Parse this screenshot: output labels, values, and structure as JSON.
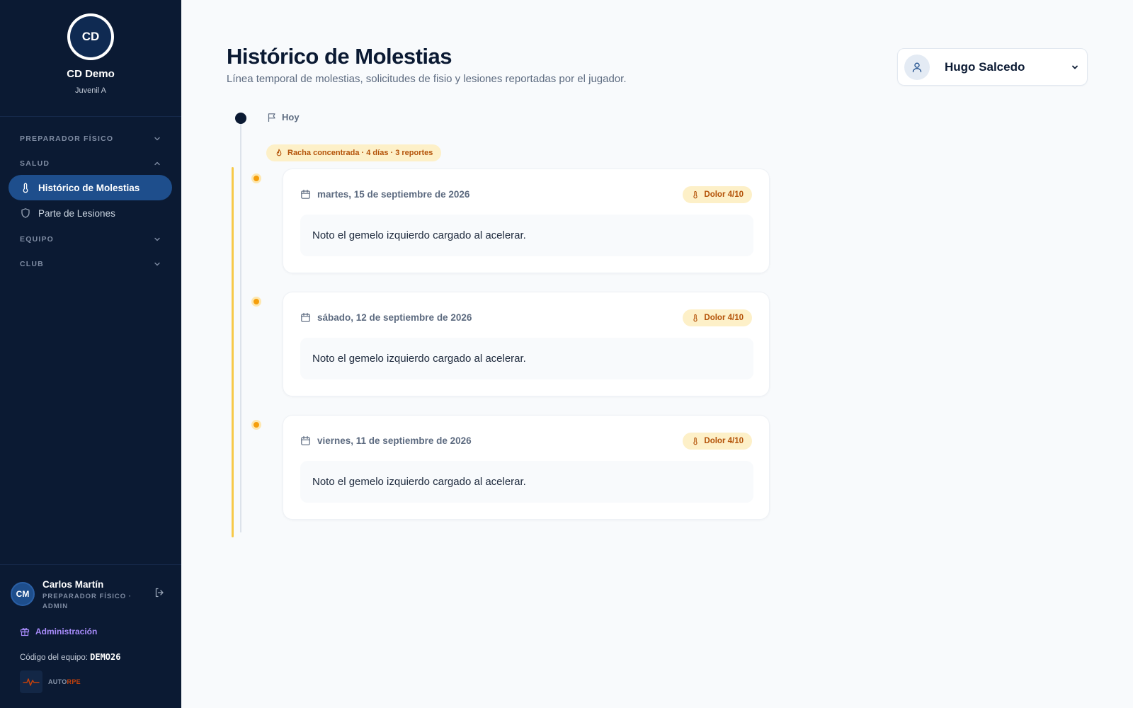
{
  "club": {
    "logo_initials": "CD",
    "name": "CD Demo",
    "team": "Juvenil A"
  },
  "nav": {
    "sections": [
      {
        "label": "PREPARADOR FÍSICO",
        "expanded": false
      },
      {
        "label": "SALUD",
        "expanded": true
      },
      {
        "label": "EQUIPO",
        "expanded": false
      },
      {
        "label": "CLUB",
        "expanded": false
      }
    ],
    "items": [
      {
        "label": "Histórico de Molestias",
        "icon": "thermometer-icon",
        "active": true
      },
      {
        "label": "Parte de Lesiones",
        "icon": "shield-icon",
        "active": false
      }
    ]
  },
  "user": {
    "initials": "CM",
    "name": "Carlos Martín",
    "role": "PREPARADOR FÍSICO · ADMIN",
    "admin_link": "Administración",
    "team_code_label": "Código del equipo:",
    "team_code": "DEMO26",
    "brand_part1": "AUTO",
    "brand_part2": "RPE"
  },
  "page": {
    "title": "Histórico de Molestias",
    "subtitle": "Línea temporal de molestias, solicitudes de fisio y lesiones reportadas por el jugador."
  },
  "player_select": {
    "selected": "Hugo Salcedo"
  },
  "timeline": {
    "today_label": "Hoy",
    "streak_label": "Racha concentrada · 4 días · 3 reportes",
    "entries": [
      {
        "date": "martes, 15 de septiembre de 2026",
        "pain": "Dolor 4/10",
        "note": "Noto el gemelo izquierdo cargado al acelerar."
      },
      {
        "date": "sábado, 12 de septiembre de 2026",
        "pain": "Dolor 4/10",
        "note": "Noto el gemelo izquierdo cargado al acelerar."
      },
      {
        "date": "viernes, 11 de septiembre de 2026",
        "pain": "Dolor 4/10",
        "note": "Noto el gemelo izquierdo cargado al acelerar."
      }
    ]
  },
  "colors": {
    "sidebar_bg": "#0b1a33",
    "active_nav": "#1e4e8c",
    "pain_accent": "#f59e0b",
    "admin_link": "#a78bfa"
  }
}
